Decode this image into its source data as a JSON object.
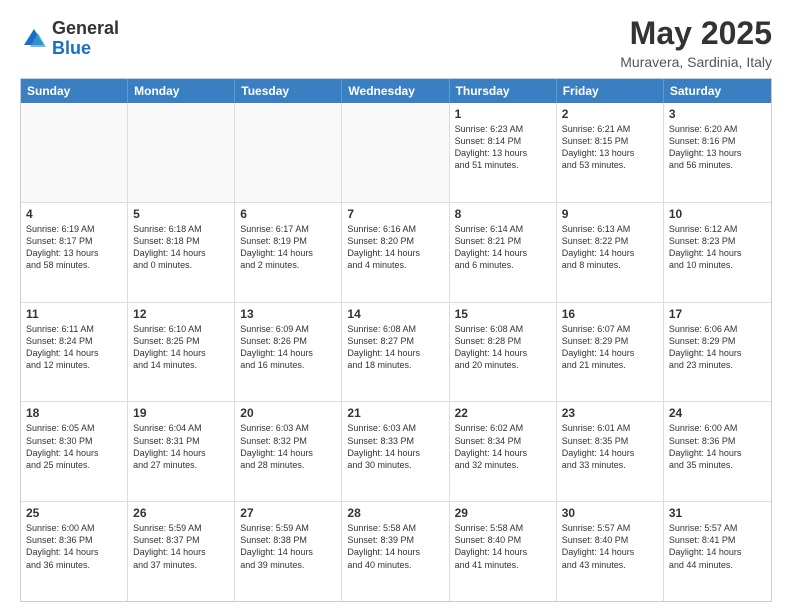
{
  "header": {
    "logo_general": "General",
    "logo_blue": "Blue",
    "month_title": "May 2025",
    "location": "Muravera, Sardinia, Italy"
  },
  "weekdays": [
    "Sunday",
    "Monday",
    "Tuesday",
    "Wednesday",
    "Thursday",
    "Friday",
    "Saturday"
  ],
  "rows": [
    [
      {
        "day": "",
        "text": "",
        "shaded": true
      },
      {
        "day": "",
        "text": "",
        "shaded": true
      },
      {
        "day": "",
        "text": "",
        "shaded": true
      },
      {
        "day": "",
        "text": "",
        "shaded": true
      },
      {
        "day": "1",
        "text": "Sunrise: 6:23 AM\nSunset: 8:14 PM\nDaylight: 13 hours\nand 51 minutes.",
        "shaded": false
      },
      {
        "day": "2",
        "text": "Sunrise: 6:21 AM\nSunset: 8:15 PM\nDaylight: 13 hours\nand 53 minutes.",
        "shaded": false
      },
      {
        "day": "3",
        "text": "Sunrise: 6:20 AM\nSunset: 8:16 PM\nDaylight: 13 hours\nand 56 minutes.",
        "shaded": false
      }
    ],
    [
      {
        "day": "4",
        "text": "Sunrise: 6:19 AM\nSunset: 8:17 PM\nDaylight: 13 hours\nand 58 minutes.",
        "shaded": false
      },
      {
        "day": "5",
        "text": "Sunrise: 6:18 AM\nSunset: 8:18 PM\nDaylight: 14 hours\nand 0 minutes.",
        "shaded": false
      },
      {
        "day": "6",
        "text": "Sunrise: 6:17 AM\nSunset: 8:19 PM\nDaylight: 14 hours\nand 2 minutes.",
        "shaded": false
      },
      {
        "day": "7",
        "text": "Sunrise: 6:16 AM\nSunset: 8:20 PM\nDaylight: 14 hours\nand 4 minutes.",
        "shaded": false
      },
      {
        "day": "8",
        "text": "Sunrise: 6:14 AM\nSunset: 8:21 PM\nDaylight: 14 hours\nand 6 minutes.",
        "shaded": false
      },
      {
        "day": "9",
        "text": "Sunrise: 6:13 AM\nSunset: 8:22 PM\nDaylight: 14 hours\nand 8 minutes.",
        "shaded": false
      },
      {
        "day": "10",
        "text": "Sunrise: 6:12 AM\nSunset: 8:23 PM\nDaylight: 14 hours\nand 10 minutes.",
        "shaded": false
      }
    ],
    [
      {
        "day": "11",
        "text": "Sunrise: 6:11 AM\nSunset: 8:24 PM\nDaylight: 14 hours\nand 12 minutes.",
        "shaded": false
      },
      {
        "day": "12",
        "text": "Sunrise: 6:10 AM\nSunset: 8:25 PM\nDaylight: 14 hours\nand 14 minutes.",
        "shaded": false
      },
      {
        "day": "13",
        "text": "Sunrise: 6:09 AM\nSunset: 8:26 PM\nDaylight: 14 hours\nand 16 minutes.",
        "shaded": false
      },
      {
        "day": "14",
        "text": "Sunrise: 6:08 AM\nSunset: 8:27 PM\nDaylight: 14 hours\nand 18 minutes.",
        "shaded": false
      },
      {
        "day": "15",
        "text": "Sunrise: 6:08 AM\nSunset: 8:28 PM\nDaylight: 14 hours\nand 20 minutes.",
        "shaded": false
      },
      {
        "day": "16",
        "text": "Sunrise: 6:07 AM\nSunset: 8:29 PM\nDaylight: 14 hours\nand 21 minutes.",
        "shaded": false
      },
      {
        "day": "17",
        "text": "Sunrise: 6:06 AM\nSunset: 8:29 PM\nDaylight: 14 hours\nand 23 minutes.",
        "shaded": false
      }
    ],
    [
      {
        "day": "18",
        "text": "Sunrise: 6:05 AM\nSunset: 8:30 PM\nDaylight: 14 hours\nand 25 minutes.",
        "shaded": false
      },
      {
        "day": "19",
        "text": "Sunrise: 6:04 AM\nSunset: 8:31 PM\nDaylight: 14 hours\nand 27 minutes.",
        "shaded": false
      },
      {
        "day": "20",
        "text": "Sunrise: 6:03 AM\nSunset: 8:32 PM\nDaylight: 14 hours\nand 28 minutes.",
        "shaded": false
      },
      {
        "day": "21",
        "text": "Sunrise: 6:03 AM\nSunset: 8:33 PM\nDaylight: 14 hours\nand 30 minutes.",
        "shaded": false
      },
      {
        "day": "22",
        "text": "Sunrise: 6:02 AM\nSunset: 8:34 PM\nDaylight: 14 hours\nand 32 minutes.",
        "shaded": false
      },
      {
        "day": "23",
        "text": "Sunrise: 6:01 AM\nSunset: 8:35 PM\nDaylight: 14 hours\nand 33 minutes.",
        "shaded": false
      },
      {
        "day": "24",
        "text": "Sunrise: 6:00 AM\nSunset: 8:36 PM\nDaylight: 14 hours\nand 35 minutes.",
        "shaded": false
      }
    ],
    [
      {
        "day": "25",
        "text": "Sunrise: 6:00 AM\nSunset: 8:36 PM\nDaylight: 14 hours\nand 36 minutes.",
        "shaded": false
      },
      {
        "day": "26",
        "text": "Sunrise: 5:59 AM\nSunset: 8:37 PM\nDaylight: 14 hours\nand 37 minutes.",
        "shaded": false
      },
      {
        "day": "27",
        "text": "Sunrise: 5:59 AM\nSunset: 8:38 PM\nDaylight: 14 hours\nand 39 minutes.",
        "shaded": false
      },
      {
        "day": "28",
        "text": "Sunrise: 5:58 AM\nSunset: 8:39 PM\nDaylight: 14 hours\nand 40 minutes.",
        "shaded": false
      },
      {
        "day": "29",
        "text": "Sunrise: 5:58 AM\nSunset: 8:40 PM\nDaylight: 14 hours\nand 41 minutes.",
        "shaded": false
      },
      {
        "day": "30",
        "text": "Sunrise: 5:57 AM\nSunset: 8:40 PM\nDaylight: 14 hours\nand 43 minutes.",
        "shaded": false
      },
      {
        "day": "31",
        "text": "Sunrise: 5:57 AM\nSunset: 8:41 PM\nDaylight: 14 hours\nand 44 minutes.",
        "shaded": false
      }
    ]
  ]
}
